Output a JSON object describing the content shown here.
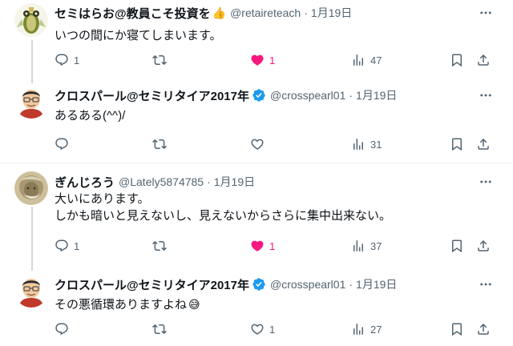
{
  "tweets": [
    {
      "name": "セミはらお@教員こそ投資を",
      "name_emoji": "👍",
      "handle": "@retaireteach",
      "date": "1月19日",
      "text": "いつの間にか寝てしまいます。",
      "replies": "1",
      "retweets": "",
      "likes": "1",
      "liked": true,
      "views": "47"
    },
    {
      "name": "クロスパール@セミリタイア2017年",
      "handle": "@crosspearl01",
      "date": "1月19日",
      "verified": true,
      "text": "あるある(^^)/",
      "replies": "",
      "retweets": "",
      "likes": "",
      "liked": false,
      "views": "31"
    },
    {
      "name": "ぎんじろう",
      "handle": "@Lately5874785",
      "date": "1月19日",
      "text_line1": "大いにあります。",
      "text_line2": "しかも暗いと見えないし、見えないからさらに集中出来ない。",
      "replies": "1",
      "retweets": "",
      "likes": "1",
      "liked": true,
      "views": "37"
    },
    {
      "name": "クロスパール@セミリタイア2017年",
      "handle": "@crosspearl01",
      "date": "1月19日",
      "verified": true,
      "text": "その悪循環ありますよね",
      "text_emoji": "😅",
      "replies": "",
      "retweets": "",
      "likes": "1",
      "liked": false,
      "views": "27"
    }
  ],
  "separator": "·",
  "icons": {
    "reply": "reply-icon",
    "retweet": "retweet-icon",
    "like": "heart-icon",
    "views": "views-icon",
    "bookmark": "bookmark-icon",
    "share": "share-icon",
    "more": "more-icon",
    "verified": "verified-badge-icon"
  },
  "colors": {
    "text": "#0f1419",
    "secondary": "#536471",
    "like": "#f91880",
    "verified": "#1d9bf0",
    "thread_line": "#cfd9de"
  }
}
